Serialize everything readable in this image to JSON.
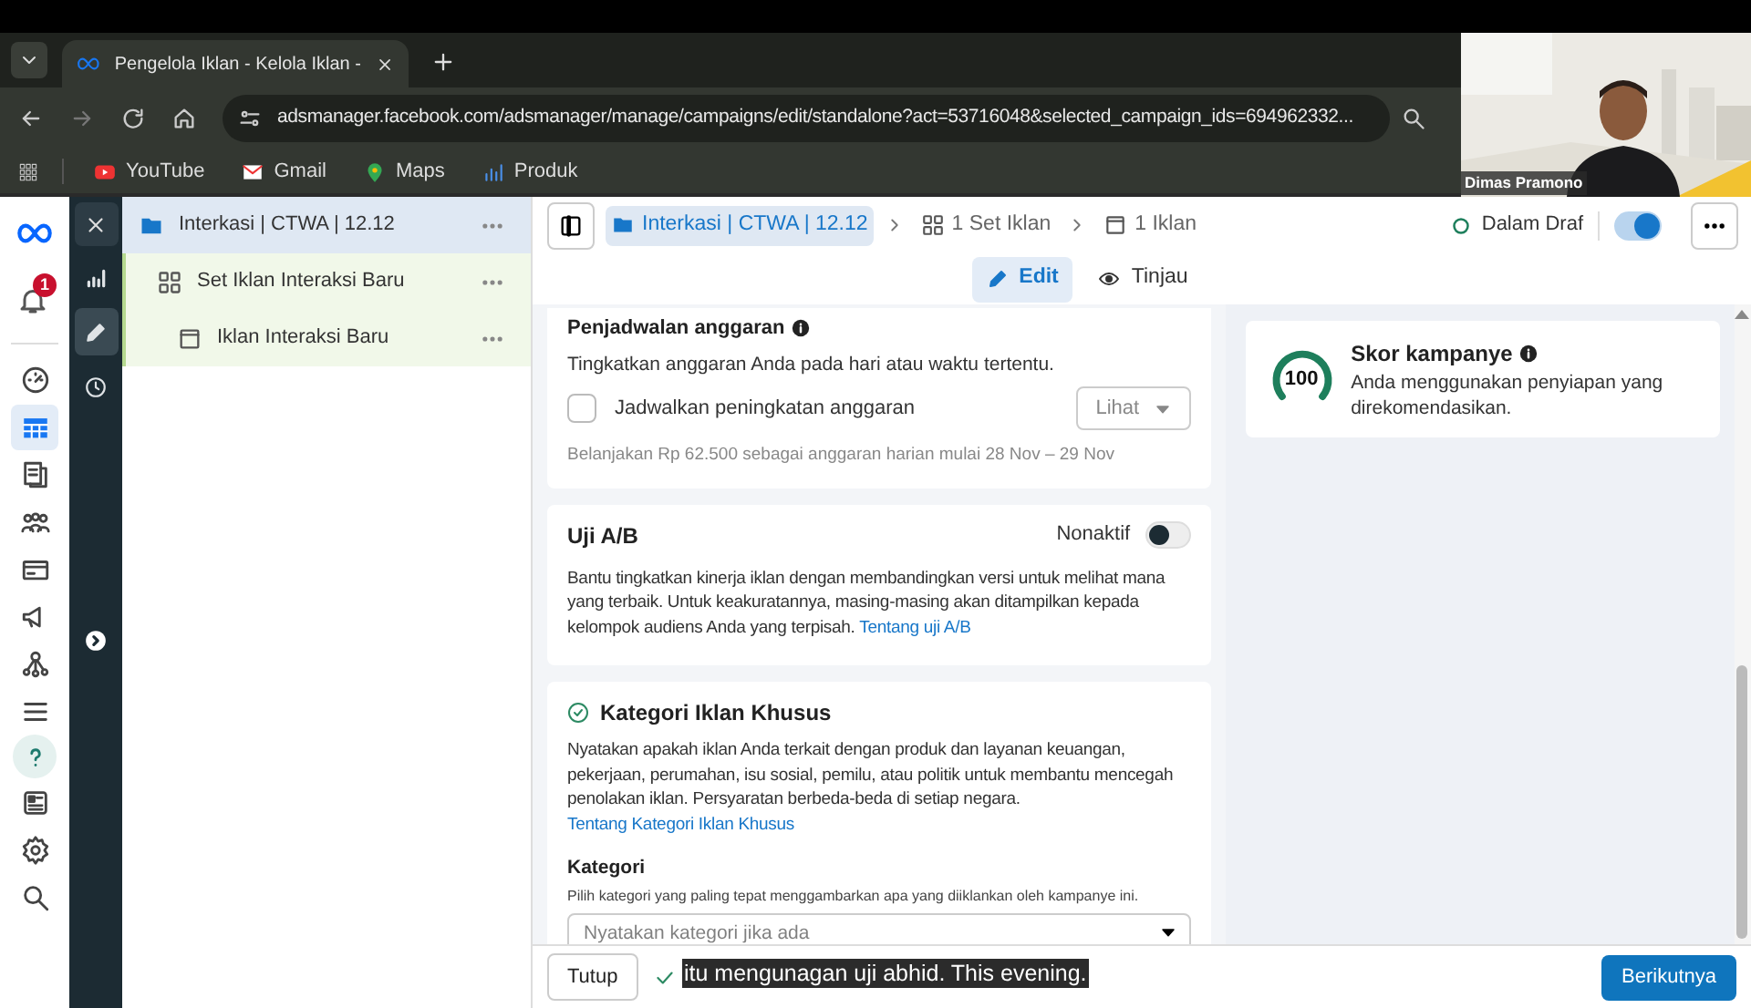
{
  "browser": {
    "tab_title": "Pengelola Iklan - Kelola Iklan -",
    "url": "adsmanager.facebook.com/adsmanager/manage/campaigns/edit/standalone?act=53716048&selected_campaign_ids=694962332...",
    "bookmarks": [
      {
        "label": "YouTube",
        "kind": "youtube"
      },
      {
        "label": "Gmail",
        "kind": "gmail"
      },
      {
        "label": "Maps",
        "kind": "maps"
      },
      {
        "label": "Produk",
        "kind": "produk"
      }
    ]
  },
  "webcam": {
    "kind": "picture",
    "name": "Dimas Pramono"
  },
  "rail": {
    "notification_count": "1",
    "items": [
      {
        "kind": "gauge",
        "selected": false
      },
      {
        "kind": "table",
        "selected": true
      },
      {
        "kind": "pages",
        "selected": false
      },
      {
        "kind": "people",
        "selected": false
      },
      {
        "kind": "card",
        "selected": false
      },
      {
        "kind": "megaphone",
        "selected": false
      },
      {
        "kind": "network",
        "selected": false
      },
      {
        "kind": "menu",
        "selected": false
      },
      {
        "kind": "help",
        "selected": false
      },
      {
        "kind": "news",
        "selected": false
      },
      {
        "kind": "settings",
        "selected": false
      },
      {
        "kind": "search",
        "selected": false
      }
    ]
  },
  "tools": [
    {
      "kind": "chart",
      "selected": false
    },
    {
      "kind": "pencil",
      "selected": true
    },
    {
      "kind": "clock",
      "selected": false
    }
  ],
  "tree": [
    {
      "label": "Interkasi | CTWA | 12.12",
      "selected": true,
      "children": [
        {
          "label": "Set Iklan Interaksi Baru",
          "selected": false,
          "children": [
            {
              "label": "Iklan Interaksi Baru",
              "selected": false
            }
          ]
        }
      ]
    }
  ],
  "breadcrumbs": [
    {
      "label": "Interkasi | CTWA | 12.12",
      "kind": "campaign",
      "selected": true
    },
    {
      "label": "1 Set Iklan",
      "kind": "adset",
      "selected": false
    },
    {
      "label": "1 Iklan",
      "kind": "ad",
      "selected": false
    }
  ],
  "status": {
    "label": "Dalam Draf",
    "on": true
  },
  "view_tabs": [
    {
      "label": "Edit",
      "kind": "edit",
      "selected": true
    },
    {
      "label": "Tinjau",
      "kind": "view",
      "selected": false
    }
  ],
  "budget_schedule": {
    "title": "Penjadwalan anggaran",
    "description": "Tingkatkan anggaran Anda pada hari atau waktu tertentu.",
    "checkbox": {
      "label": "Jadwalkan peningkatan anggaran",
      "checked": false
    },
    "dropdown": "Lihat",
    "note": "Belanjakan Rp 62.500 sebagai anggaran harian mulai 28 Nov – 29 Nov"
  },
  "ab_test": {
    "title": "Uji A/B",
    "toggle_label": "Nonaktif",
    "on": false,
    "text": "Bantu tingkatkan kinerja iklan dengan membandingkan versi untuk melihat mana yang terbaik. Untuk keakuratannya, masing-masing akan ditampilkan kepada kelompok audiens Anda yang terpisah.",
    "link": "Tentang uji A/B"
  },
  "special_category": {
    "title": "Kategori Iklan Khusus",
    "text": "Nyatakan apakah iklan Anda terkait dengan produk dan layanan keuangan, pekerjaan, perumahan, isu sosial, pemilu, atau politik untuk membantu mencegah penolakan iklan. Persyaratan berbeda-beda di setiap negara.",
    "link": "Tentang Kategori Iklan Khusus",
    "field": {
      "label": "Kategori",
      "hint": "Pilih kategori yang paling tepat menggambarkan apa yang diiklankan oleh kampanye ini.",
      "placeholder": "Nyatakan kategori jika ada"
    }
  },
  "score": {
    "value": "100",
    "title": "Skor kampanye",
    "description": "Anda menggunakan penyiapan yang direkomendasikan."
  },
  "footer": {
    "close": "Tutup",
    "next": "Berikutnya"
  },
  "caption": "itu mengunagan uji abhid. This evening."
}
